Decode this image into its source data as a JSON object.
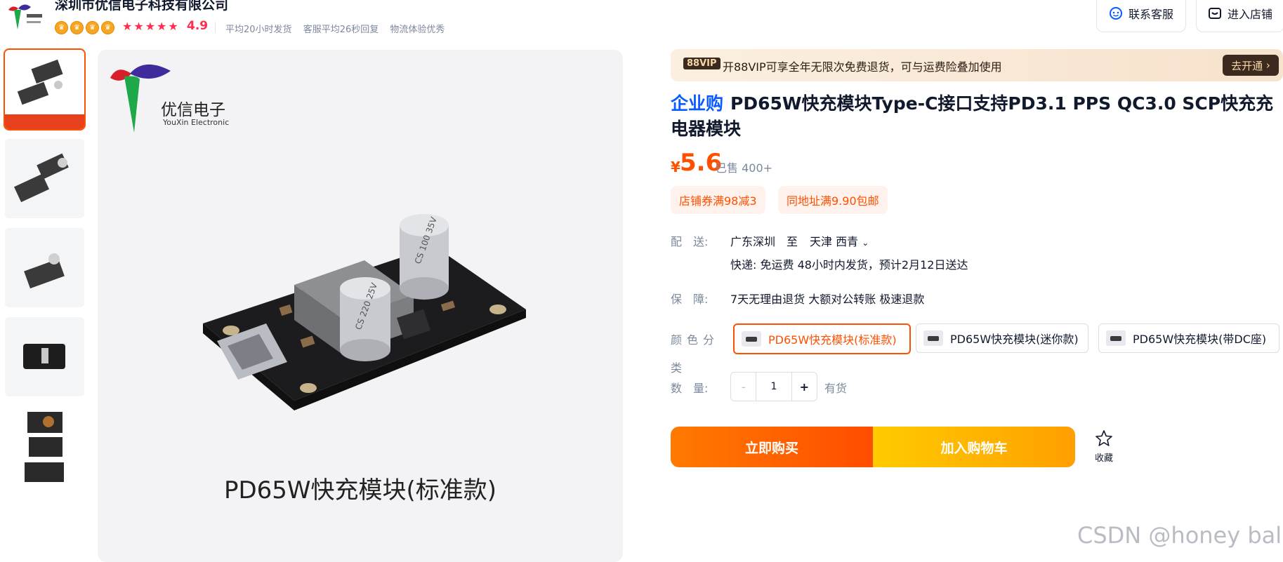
{
  "shop": {
    "name": "深圳市优信电子科技有限公司",
    "crown_count": 4,
    "rating": "4.9",
    "stats": [
      "平均20小时发货",
      "客服平均26秒回复",
      "物流体验优秀"
    ],
    "contact_label": "联系客服",
    "store_label": "进入店铺"
  },
  "gallery": {
    "brand_cn": "优信电子",
    "brand_en": "YouXin Electronic",
    "caption": "PD65W快充模块(标准款)",
    "thumbnail_count": 5,
    "cap_labels": [
      "CS 100 35V",
      "CS 220 25V"
    ]
  },
  "vip": {
    "badge": "88VIP",
    "text": "开88VIP可享全年无限次免费退货，可与运费险叠加使用",
    "open_label": "去开通"
  },
  "product": {
    "tag": "企业购",
    "title": "PD65W快充模块Type-C接口支持PD3.1 PPS QC3.0 SCP快充充电器模块",
    "price_symbol": "¥",
    "price": "5.6",
    "sold": "已售 400+",
    "coupons": [
      "店铺券满98减3",
      "同地址满9.90包邮"
    ]
  },
  "delivery": {
    "label": "配　送:",
    "from": "广东深圳",
    "to_word": "至",
    "dest": "天津 西青",
    "detail": "快递: 免运费  48小时内发货，预计2月12日送达"
  },
  "guarantee": {
    "label": "保　障:",
    "text": "7天无理由退货 大额对公转账 极速退款"
  },
  "sku": {
    "label_top": "颜色分",
    "label_bottom": "类",
    "options": [
      "PD65W快充模块(标准款)",
      "PD65W快充模块(迷你款)",
      "PD65W快充模块(带DC座)"
    ],
    "selected_index": 0
  },
  "quantity": {
    "label": "数　量:",
    "minus": "-",
    "value": "1",
    "plus": "+",
    "stock": "有货"
  },
  "actions": {
    "buy_now": "立即购买",
    "add_cart": "加入购物车",
    "favorite": "收藏"
  },
  "watermark": "CSDN @honey ball",
  "colors": {
    "accent": "#ff5000",
    "brand_blue": "#0a5bff",
    "rating_red": "#ff2d4e"
  }
}
